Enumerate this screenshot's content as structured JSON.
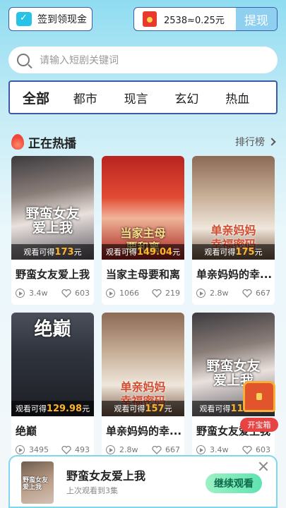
{
  "header": {
    "checkin_label": "签到领现金",
    "coins_text": "2538≈0.25元",
    "withdraw_label": "提现",
    "calendar_icon": "calendar-check-icon",
    "redpacket_icon": "red-envelope-icon"
  },
  "search": {
    "placeholder": "请输入短剧关键词"
  },
  "tabs": [
    {
      "label": "全部",
      "active": true
    },
    {
      "label": "都市",
      "active": false
    },
    {
      "label": "现言",
      "active": false
    },
    {
      "label": "玄幻",
      "active": false
    },
    {
      "label": "热血",
      "active": false
    }
  ],
  "section": {
    "title": "正在热播",
    "ranking_label": "排行榜"
  },
  "cards": [
    {
      "poster_caption": "野蛮女友\n爱上我",
      "earn_prefix": "观看可得",
      "earn_amount": "173",
      "earn_suffix": "元",
      "title": "野蛮女友爱上我",
      "plays": "3.4w",
      "likes": "603"
    },
    {
      "poster_caption": "当家主母\n要和离",
      "earn_prefix": "观看可得",
      "earn_amount": "149.04",
      "earn_suffix": "元",
      "title": "当家主母要和离",
      "plays": "1066",
      "likes": "219"
    },
    {
      "poster_caption": "单亲妈妈\n幸福密码",
      "earn_prefix": "观看可得",
      "earn_amount": "175",
      "earn_suffix": "元",
      "title": "单亲妈妈的幸...",
      "plays": "2.8w",
      "likes": "667"
    },
    {
      "poster_caption": "绝巅",
      "earn_prefix": "观看可得",
      "earn_amount": "129.98",
      "earn_suffix": "元",
      "title": "绝巅",
      "plays": "3495",
      "likes": "493"
    },
    {
      "poster_caption": "单亲妈妈\n幸福密码",
      "earn_prefix": "观看可得",
      "earn_amount": "157",
      "earn_suffix": "元",
      "title": "单亲妈妈的幸...",
      "plays": "2.8w",
      "likes": "667"
    },
    {
      "poster_caption": "野蛮女友\n爱上我",
      "earn_prefix": "观看可得",
      "earn_amount": "115.9",
      "earn_suffix": "元",
      "title": "野蛮女友爱上我",
      "plays": "3.4w",
      "likes": "603"
    }
  ],
  "treasure": {
    "label": "开宝箱"
  },
  "continue_bar": {
    "title": "野蛮女友爱上我",
    "subtitle": "上次观看到3集",
    "button_label": "继续观看",
    "thumb_caption": "野蛮女友爱上我"
  },
  "colors": {
    "accent": "#27c3e6",
    "earn_amount": "#ffb429",
    "tab_border": "#3e5aa5"
  }
}
